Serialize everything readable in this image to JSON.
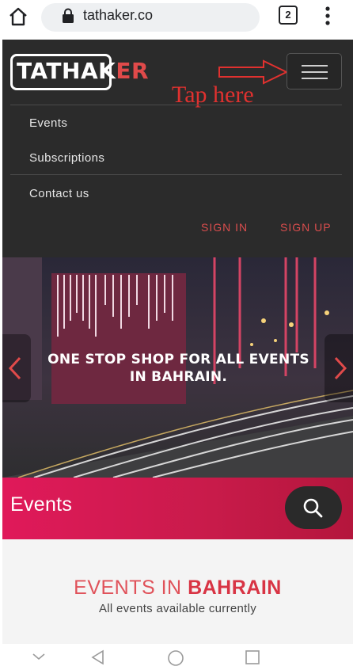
{
  "browser": {
    "url": "tathaker.co",
    "tab_count": "2",
    "icons": [
      "home-icon",
      "lock-icon",
      "tabs-icon",
      "more-vert-icon"
    ]
  },
  "site": {
    "logo": {
      "text_white": "TATHAK",
      "text_red": "ER"
    },
    "annotation": "Tap here",
    "nav": [
      {
        "label": "Events"
      },
      {
        "label": "Subscriptions"
      },
      {
        "label": "Contact us"
      }
    ],
    "sign_in": "SIGN IN",
    "sign_up": "SIGN UP"
  },
  "hero": {
    "headline_line1": "ONE STOP SHOP FOR ALL EVENTS",
    "headline_line2": "IN BAHRAIN."
  },
  "events_bar": {
    "label": "Events",
    "icon": "search-icon"
  },
  "events_section": {
    "title_light": "EVENTS IN",
    "title_bold": "BAHRAIN",
    "subtitle": "All events available currently"
  },
  "colors": {
    "accent_red": "#d83444",
    "header_bg": "#2b2b2b",
    "events_bar_start": "#e0195a",
    "events_bar_end": "#b4163c"
  }
}
